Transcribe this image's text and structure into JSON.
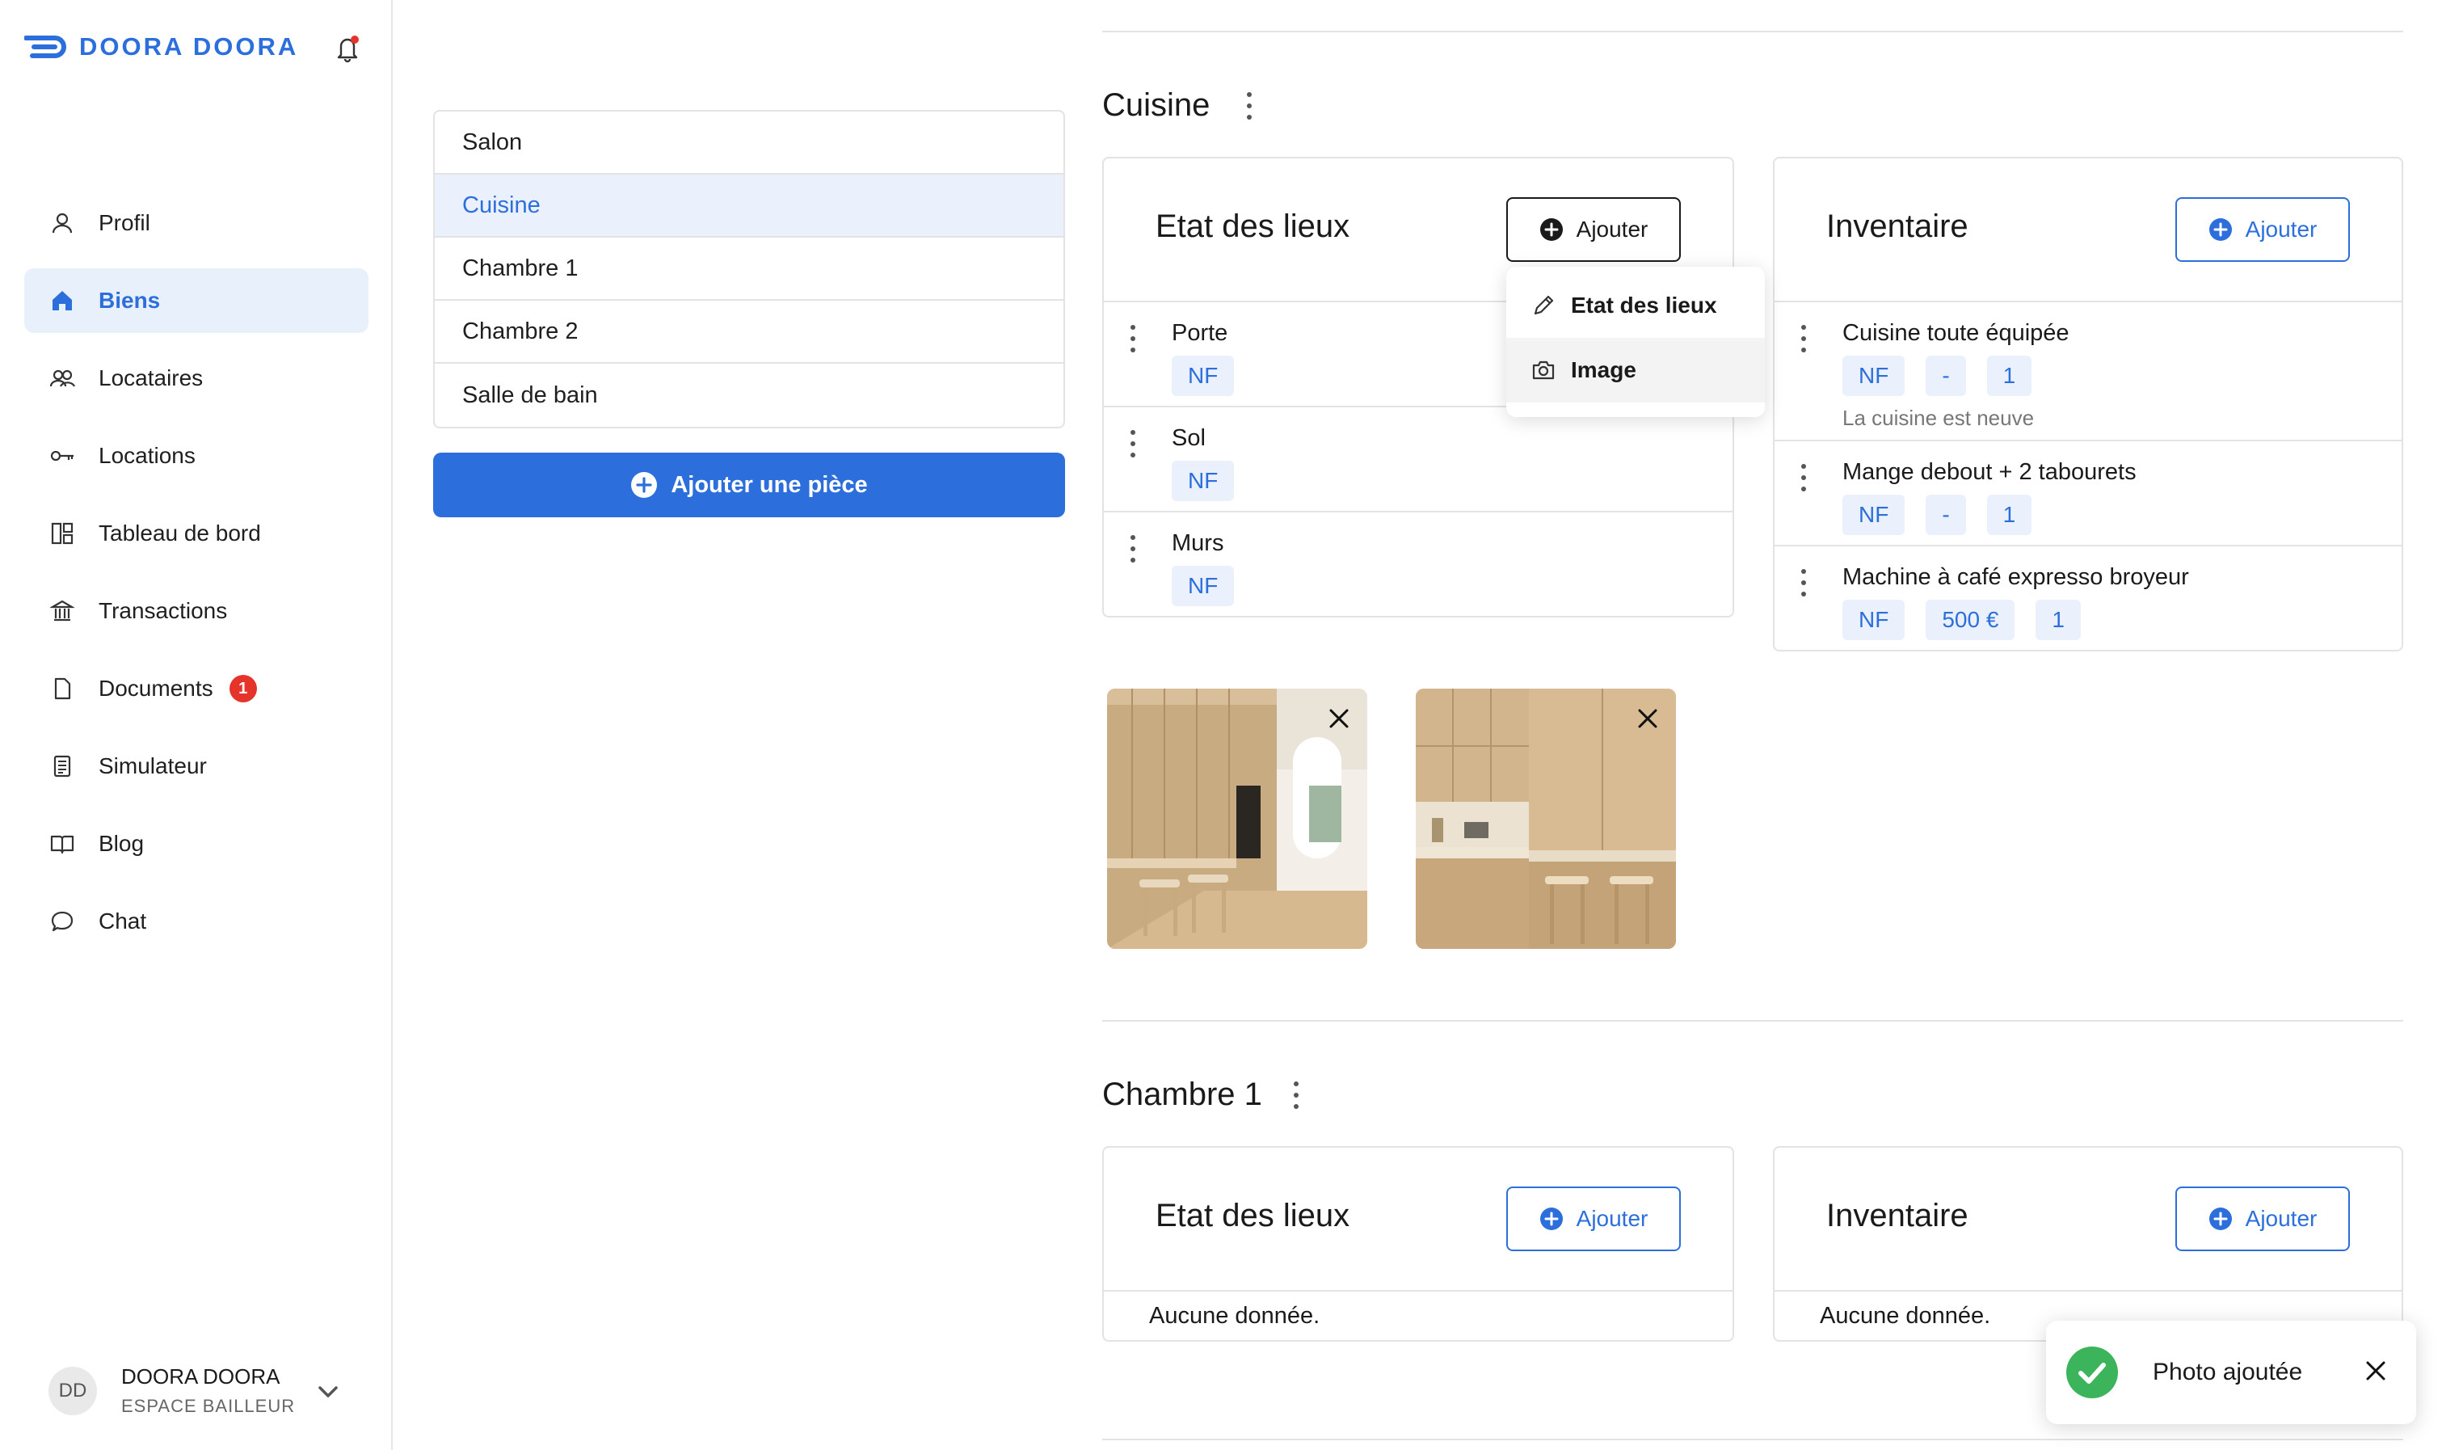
{
  "brand": {
    "name": "DOORA DOORA",
    "color": "#2c6fdc"
  },
  "header": {
    "bell_icon": "bell-icon"
  },
  "sidebar": {
    "items": [
      {
        "label": "Profil",
        "icon": "user-icon"
      },
      {
        "label": "Biens",
        "icon": "home-icon",
        "active": true
      },
      {
        "label": "Locataires",
        "icon": "users-icon"
      },
      {
        "label": "Locations",
        "icon": "key-icon"
      },
      {
        "label": "Tableau de bord",
        "icon": "dashboard-icon"
      },
      {
        "label": "Transactions",
        "icon": "bank-icon"
      },
      {
        "label": "Documents",
        "icon": "document-icon",
        "badge": "1"
      },
      {
        "label": "Simulateur",
        "icon": "calculator-icon"
      },
      {
        "label": "Blog",
        "icon": "book-icon"
      },
      {
        "label": "Chat",
        "icon": "chat-icon"
      }
    ]
  },
  "user": {
    "initials": "DD",
    "name": "DOORA DOORA",
    "role": "ESPACE BAILLEUR"
  },
  "rooms": {
    "items": [
      "Salon",
      "Cuisine",
      "Chambre 1",
      "Chambre 2",
      "Salle de bain"
    ],
    "active": "Cuisine",
    "add_label": "Ajouter une pièce"
  },
  "sections": [
    {
      "title": "Cuisine",
      "etat": {
        "title": "Etat des lieux",
        "add_label": "Ajouter",
        "rows": [
          {
            "title": "Porte",
            "chips": [
              "NF"
            ]
          },
          {
            "title": "Sol",
            "chips": [
              "NF"
            ]
          },
          {
            "title": "Murs",
            "chips": [
              "NF"
            ]
          }
        ]
      },
      "inventaire": {
        "title": "Inventaire",
        "add_label": "Ajouter",
        "rows": [
          {
            "title": "Cuisine toute équipée",
            "chips": [
              "NF",
              "-",
              "1"
            ],
            "note": "La cuisine est neuve"
          },
          {
            "title": "Mange debout + 2 tabourets",
            "chips": [
              "NF",
              "-",
              "1"
            ]
          },
          {
            "title": "Machine à café expresso broyeur",
            "chips": [
              "NF",
              "500 €",
              "1"
            ]
          }
        ]
      }
    },
    {
      "title": "Chambre 1",
      "etat": {
        "title": "Etat des lieux",
        "add_label": "Ajouter",
        "empty": "Aucune donnée."
      },
      "inventaire": {
        "title": "Inventaire",
        "add_label": "Ajouter",
        "empty": "Aucune donnée."
      }
    }
  ],
  "dropdown": {
    "items": [
      {
        "label": "Etat des lieux",
        "icon": "pencil-icon"
      },
      {
        "label": "Image",
        "icon": "camera-icon"
      }
    ]
  },
  "toast": {
    "message": "Photo ajoutée",
    "status_color": "#3cb45c"
  },
  "colors": {
    "accent": "#2c6fdc",
    "chip_bg": "#eaf1fc",
    "badge": "#e5342a"
  }
}
